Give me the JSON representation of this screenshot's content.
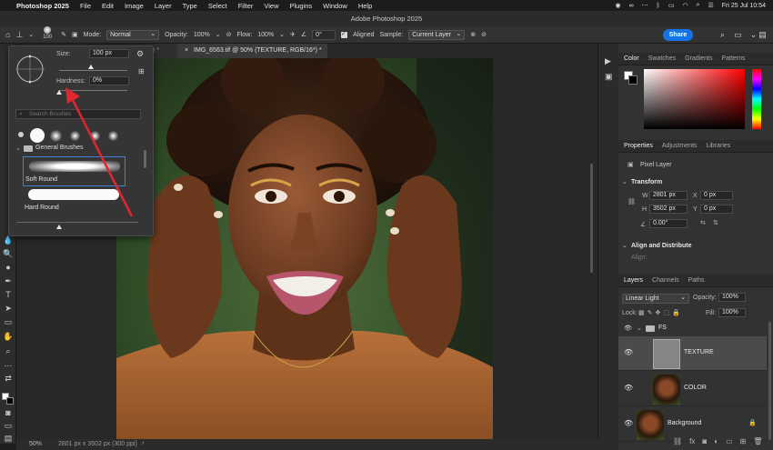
{
  "menubar": {
    "app": "Photoshop 2025",
    "menus": [
      "File",
      "Edit",
      "Image",
      "Layer",
      "Type",
      "Select",
      "Filter",
      "View",
      "Plugins",
      "Window",
      "Help"
    ],
    "datetime": "Fri 25 Jul 10:54"
  },
  "window": {
    "title": "Adobe Photoshop 2025"
  },
  "options": {
    "brush_size": "100",
    "mode_label": "Mode:",
    "mode_value": "Normal",
    "opacity_label": "Opacity:",
    "opacity_value": "100%",
    "flow_label": "Flow:",
    "flow_value": "100%",
    "angle_value": "0°",
    "aligned_label": "Aligned",
    "sample_label": "Sample:",
    "sample_value": "Current Layer",
    "share_label": "Share"
  },
  "document": {
    "tab_title": "IMG_6563.tif @ 50% (TEXTURE, RGB/16*) *",
    "prev_tab": "8) *",
    "zoom": "50%",
    "doc_size": "2801 px x 3502 px (300 ppi)"
  },
  "brush_popup": {
    "size_label": "Size:",
    "size_value": "100 px",
    "hardness_label": "Hardness:",
    "hardness_value": "0%",
    "search_placeholder": "Search Brushes",
    "group_name": "General Brushes",
    "brushes": [
      "Soft Round",
      "Hard Round"
    ]
  },
  "panels": {
    "color_tabs": [
      "Color",
      "Swatches",
      "Gradients",
      "Patterns"
    ],
    "props_tabs": [
      "Properties",
      "Adjustments",
      "Libraries"
    ],
    "pixel_layer": "Pixel Layer",
    "transform_title": "Transform",
    "w_label": "W",
    "w_value": "2801 px",
    "x_label": "X",
    "x_value": "0 px",
    "h_label": "H",
    "h_value": "3502 px",
    "y_label": "Y",
    "y_value": "0 px",
    "angle_value": "0.00°",
    "align_title": "Align and Distribute",
    "align_sub": "Align:",
    "layers_tabs": [
      "Layers",
      "Channels",
      "Paths"
    ],
    "blend_mode": "Linear Light",
    "opacity_label": "Opacity:",
    "opacity_value": "100%",
    "lock_label": "Lock:",
    "fill_label": "Fill:",
    "fill_value": "100%",
    "group_name": "FS",
    "layers": [
      "TEXTURE",
      "COLOR",
      "Background"
    ]
  },
  "colors": {
    "accent": "#1473e6",
    "annotation_arrow": "#e0262e"
  }
}
